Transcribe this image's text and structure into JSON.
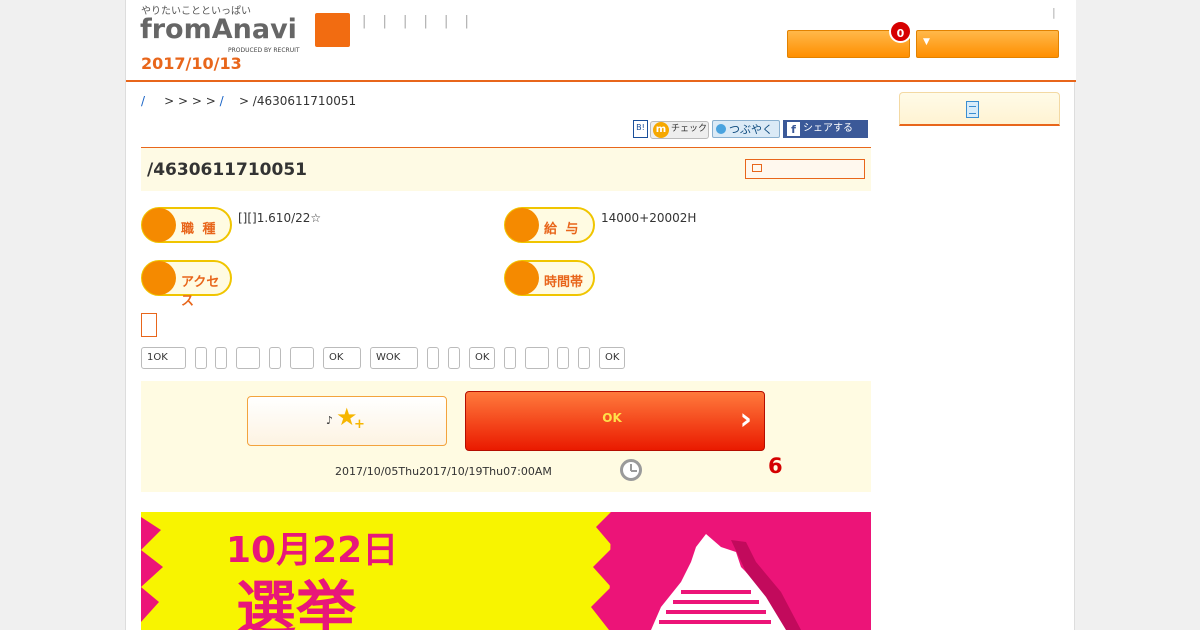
{
  "header": {
    "tagline": "やりたいことといっぱい",
    "logo": "fromAnavi",
    "produced_by": "PRODUCED BY RECRUIT",
    "nav_dots": "| | | | | |",
    "date": "2017/10/13",
    "pipe": "|",
    "badge_count": "0",
    "dropdown_arrow": "▼"
  },
  "breadcrumb": {
    "home": "/",
    "separators": "> > > >",
    "link": "/",
    "current": "> /4630611710051"
  },
  "social": {
    "hatena": "B!",
    "check_icon": "m",
    "check": "チェック",
    "tweet": "つぶやく",
    "facebook_icon": "f",
    "facebook": "シェアする"
  },
  "job": {
    "title": "/4630611710051",
    "occupation_label": "職 種",
    "occupation_value": "[][]1.610/22☆",
    "salary_label": "給 与",
    "salary_value": "14000+20002H",
    "access_label": "アクセス",
    "time_label": "時間帯"
  },
  "tags": [
    "1OK",
    "",
    "",
    "",
    "",
    "",
    "OK",
    "WOK",
    "",
    "",
    "OK",
    "",
    "",
    "",
    "",
    "OK"
  ],
  "cta": {
    "fav_note": "♪",
    "apply_label": "OK",
    "apply_chevron": "›",
    "period": "2017/10/05Thu2017/10/19Thu07:00AM",
    "days_left": "6"
  },
  "banner": {
    "date_text": "10月22日",
    "bottom_text": "選挙"
  },
  "colors": {
    "accent": "#e8661b",
    "cta_red": "#ea1a00",
    "banner_pink": "#ec1478",
    "banner_yellow": "#f8f400"
  }
}
